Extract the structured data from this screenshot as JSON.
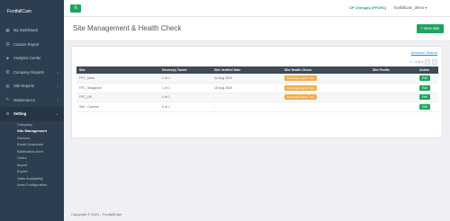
{
  "brand": {
    "name": "FootfallCam"
  },
  "sidebar": {
    "items": [
      {
        "label": "My Dashboard",
        "icon": "dashboard-icon",
        "chevron": false
      },
      {
        "label": "Custom Report",
        "icon": "report-icon",
        "chevron": false
      },
      {
        "label": "Analytics Center",
        "icon": "analytics-icon",
        "chevron": false
      },
      {
        "label": "Company Reports",
        "icon": "chart-icon",
        "chevron": true
      },
      {
        "label": "Site Reports",
        "icon": "chart-icon",
        "chevron": true
      },
      {
        "label": "Maintenance",
        "icon": "wrench-icon",
        "chevron": true
      },
      {
        "label": "Setting",
        "icon": "gear-icon",
        "chevron": true
      }
    ],
    "sub_items": [
      "Company",
      "Site Management",
      "Devices",
      "Email Scheduler",
      "Notification Alert",
      "Users",
      "Import",
      "Export",
      "Stats Availability",
      "Area Configuration"
    ]
  },
  "topbar": {
    "menu_icon": "hamburger-icon",
    "org": "CP Chengdu (FFCRC)",
    "user": "footfallcam_demo",
    "user_caret": "▾"
  },
  "header": {
    "title": "Site Management & Health Check",
    "new_site_label": "+ New Site"
  },
  "panel": {
    "advance_search": "Advance Search",
    "pager_text": "1 - 4 of 4"
  },
  "table": {
    "columns": [
      "Site",
      "Device(s) Tuned",
      "Site Verified Date",
      "Site Health Check",
      "Site Profile",
      "Action"
    ],
    "rows": [
      {
        "site": "FFC_Mica",
        "tuned": "1 of 1",
        "verified": "04 Aug 2020",
        "health": "Data Aggregation: N/A",
        "profile": "",
        "action": "Edit"
      },
      {
        "site": "FFC_Singapore",
        "tuned": "1 of 1",
        "verified": "18 Aug 2020",
        "health": "Data Aggregation: N/A",
        "profile": "",
        "action": "Edit"
      },
      {
        "site": "FFC_UK",
        "tuned": "0 of 1",
        "verified": "-",
        "health": "Data Aggregation: N/A",
        "profile": "",
        "action": "Edit"
      },
      {
        "site": "Site - Cannon",
        "tuned": "0 of 1",
        "verified": "-",
        "health": "",
        "profile": "",
        "action": "Edit"
      }
    ]
  },
  "footer": {
    "copyright": "Copyright © 2021 - FootfallCam"
  },
  "colors": {
    "accent": "#1fa35f",
    "sidebar_bg": "#2c3e50",
    "warning": "#f0ad4e",
    "table_header": "#3e4a56"
  }
}
